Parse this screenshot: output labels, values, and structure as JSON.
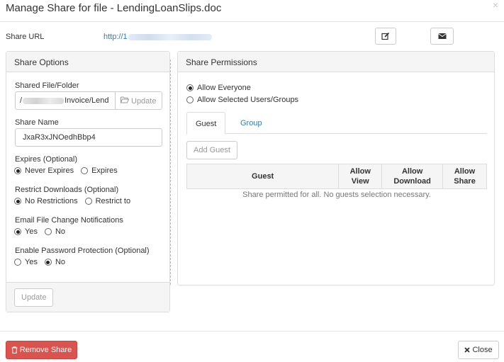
{
  "dialog": {
    "title": "Manage Share for file - LendingLoanSlips.doc",
    "close_glyph": "×"
  },
  "share_url": {
    "label": "Share URL",
    "value_prefix": "http://1",
    "edit_icon": "edit-icon",
    "email_icon": "envelope-icon"
  },
  "share_options": {
    "heading": "Share Options",
    "shared_file": {
      "label": "Shared File/Folder",
      "value_start": "/",
      "value_end": "Invoice/Lend",
      "update_label": "Update",
      "icon": "folder-open-icon"
    },
    "share_name": {
      "label": "Share Name",
      "value": "JxaR3xJNOedhBbp4"
    },
    "expires": {
      "label": "Expires (Optional)",
      "options": [
        "Never Expires",
        "Expires"
      ],
      "selected": "Never Expires"
    },
    "restrict_downloads": {
      "label": "Restrict Downloads (Optional)",
      "options": [
        "No Restrictions",
        "Restrict to"
      ],
      "selected": "No Restrictions"
    },
    "email_notifications": {
      "label": "Email File Change Notifications",
      "options": [
        "Yes",
        "No"
      ],
      "selected": "Yes"
    },
    "password_protection": {
      "label": "Enable Password Protection (Optional)",
      "options": [
        "Yes",
        "No"
      ],
      "selected": "No"
    },
    "footer_update_label": "Update"
  },
  "share_permissions": {
    "heading": "Share Permissions",
    "options": [
      "Allow Everyone",
      "Allow Selected Users/Groups"
    ],
    "selected": "Allow Everyone",
    "tabs": [
      {
        "label": "Guest",
        "active": true
      },
      {
        "label": "Group",
        "active": false
      }
    ],
    "add_guest_label": "Add Guest",
    "table_headers": [
      "Guest",
      "Allow View",
      "Allow Download",
      "Allow Share"
    ],
    "empty_message": "Share permitted for all. No guests selection necessary."
  },
  "footer": {
    "remove_label": "Remove Share",
    "remove_icon": "trash-icon",
    "close_label": "Close",
    "close_icon": "times-icon",
    "colors": {
      "danger": "#d9534f",
      "link": "#337ab7"
    }
  }
}
